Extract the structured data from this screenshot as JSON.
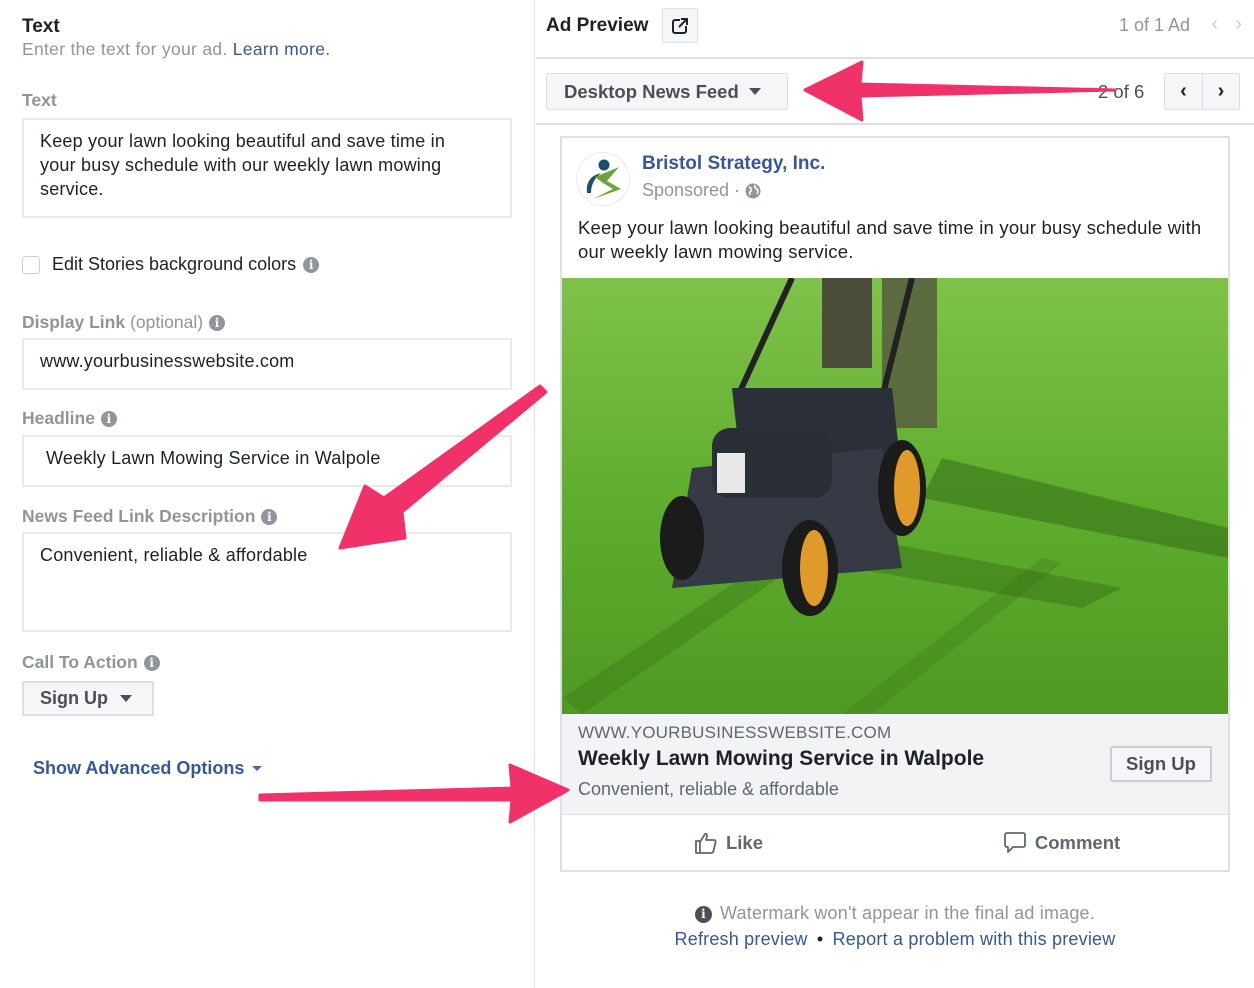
{
  "left": {
    "section_title": "Text",
    "section_subtitle": "Enter the text for your ad.",
    "learn_more": "Learn more.",
    "text_label": "Text",
    "text_value": "Keep your lawn looking beautiful and save time in your busy schedule with our weekly lawn mowing service.",
    "stories_checkbox_label": "Edit Stories background colors",
    "stories_checked": false,
    "display_link_label": "Display Link",
    "display_link_optional": "(optional)",
    "display_link_value": "www.yourbusinesswebsite.com",
    "headline_label": "Headline",
    "headline_value": "Weekly Lawn Mowing Service in Walpole",
    "desc_label": "News Feed Link Description",
    "desc_value": "Convenient, reliable & affordable",
    "cta_label": "Call To Action",
    "cta_value": "Sign Up",
    "advanced_label": "Show Advanced Options"
  },
  "preview": {
    "title": "Ad Preview",
    "ad_count": "1 of 1 Ad",
    "placement": "Desktop News Feed",
    "placement_count": "2 of 6",
    "prev_icon": "chevron-left",
    "next_icon": "chevron-right"
  },
  "ad": {
    "page_name": "Bristol Strategy, Inc.",
    "sponsored": "Sponsored ·",
    "post_text": "Keep your lawn looking beautiful and save time in your busy schedule with our weekly lawn mowing service.",
    "image_alt": "Lawn mower on green grass",
    "link_url": "WWW.YOURBUSINESSWEBSITE.COM",
    "link_headline": "Weekly Lawn Mowing Service in Walpole",
    "link_description": "Convenient, reliable & affordable",
    "cta_button": "Sign Up",
    "like_label": "Like",
    "comment_label": "Comment"
  },
  "footer": {
    "watermark_note": "Watermark won't appear in the final ad image.",
    "refresh_link": "Refresh preview",
    "separator": "•",
    "report_link": "Report a problem with this preview"
  },
  "colors": {
    "link_blue": "#365899",
    "annotation_arrow": "#f0316a",
    "muted_text": "#90949c"
  }
}
